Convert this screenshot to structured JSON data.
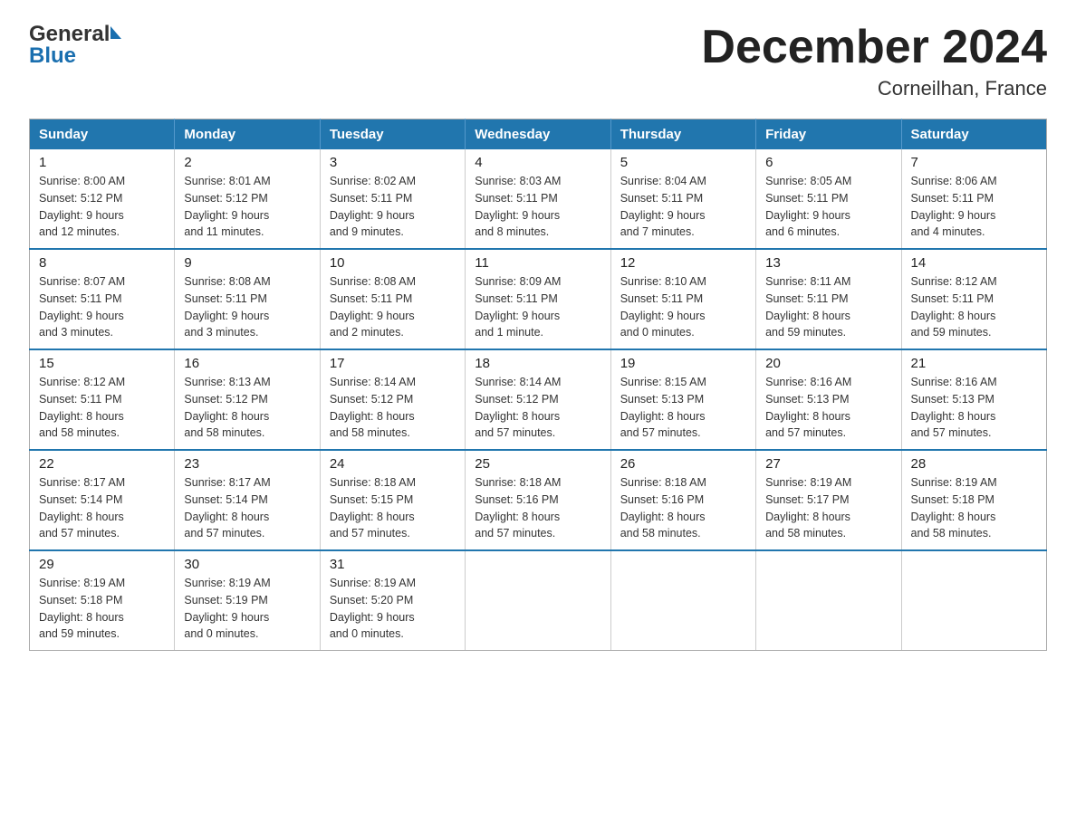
{
  "header": {
    "logo_line1": "General",
    "logo_line2": "Blue",
    "title": "December 2024",
    "subtitle": "Corneilhan, France"
  },
  "calendar": {
    "days_of_week": [
      "Sunday",
      "Monday",
      "Tuesday",
      "Wednesday",
      "Thursday",
      "Friday",
      "Saturday"
    ],
    "weeks": [
      [
        {
          "day": "1",
          "info": "Sunrise: 8:00 AM\nSunset: 5:12 PM\nDaylight: 9 hours\nand 12 minutes."
        },
        {
          "day": "2",
          "info": "Sunrise: 8:01 AM\nSunset: 5:12 PM\nDaylight: 9 hours\nand 11 minutes."
        },
        {
          "day": "3",
          "info": "Sunrise: 8:02 AM\nSunset: 5:11 PM\nDaylight: 9 hours\nand 9 minutes."
        },
        {
          "day": "4",
          "info": "Sunrise: 8:03 AM\nSunset: 5:11 PM\nDaylight: 9 hours\nand 8 minutes."
        },
        {
          "day": "5",
          "info": "Sunrise: 8:04 AM\nSunset: 5:11 PM\nDaylight: 9 hours\nand 7 minutes."
        },
        {
          "day": "6",
          "info": "Sunrise: 8:05 AM\nSunset: 5:11 PM\nDaylight: 9 hours\nand 6 minutes."
        },
        {
          "day": "7",
          "info": "Sunrise: 8:06 AM\nSunset: 5:11 PM\nDaylight: 9 hours\nand 4 minutes."
        }
      ],
      [
        {
          "day": "8",
          "info": "Sunrise: 8:07 AM\nSunset: 5:11 PM\nDaylight: 9 hours\nand 3 minutes."
        },
        {
          "day": "9",
          "info": "Sunrise: 8:08 AM\nSunset: 5:11 PM\nDaylight: 9 hours\nand 3 minutes."
        },
        {
          "day": "10",
          "info": "Sunrise: 8:08 AM\nSunset: 5:11 PM\nDaylight: 9 hours\nand 2 minutes."
        },
        {
          "day": "11",
          "info": "Sunrise: 8:09 AM\nSunset: 5:11 PM\nDaylight: 9 hours\nand 1 minute."
        },
        {
          "day": "12",
          "info": "Sunrise: 8:10 AM\nSunset: 5:11 PM\nDaylight: 9 hours\nand 0 minutes."
        },
        {
          "day": "13",
          "info": "Sunrise: 8:11 AM\nSunset: 5:11 PM\nDaylight: 8 hours\nand 59 minutes."
        },
        {
          "day": "14",
          "info": "Sunrise: 8:12 AM\nSunset: 5:11 PM\nDaylight: 8 hours\nand 59 minutes."
        }
      ],
      [
        {
          "day": "15",
          "info": "Sunrise: 8:12 AM\nSunset: 5:11 PM\nDaylight: 8 hours\nand 58 minutes."
        },
        {
          "day": "16",
          "info": "Sunrise: 8:13 AM\nSunset: 5:12 PM\nDaylight: 8 hours\nand 58 minutes."
        },
        {
          "day": "17",
          "info": "Sunrise: 8:14 AM\nSunset: 5:12 PM\nDaylight: 8 hours\nand 58 minutes."
        },
        {
          "day": "18",
          "info": "Sunrise: 8:14 AM\nSunset: 5:12 PM\nDaylight: 8 hours\nand 57 minutes."
        },
        {
          "day": "19",
          "info": "Sunrise: 8:15 AM\nSunset: 5:13 PM\nDaylight: 8 hours\nand 57 minutes."
        },
        {
          "day": "20",
          "info": "Sunrise: 8:16 AM\nSunset: 5:13 PM\nDaylight: 8 hours\nand 57 minutes."
        },
        {
          "day": "21",
          "info": "Sunrise: 8:16 AM\nSunset: 5:13 PM\nDaylight: 8 hours\nand 57 minutes."
        }
      ],
      [
        {
          "day": "22",
          "info": "Sunrise: 8:17 AM\nSunset: 5:14 PM\nDaylight: 8 hours\nand 57 minutes."
        },
        {
          "day": "23",
          "info": "Sunrise: 8:17 AM\nSunset: 5:14 PM\nDaylight: 8 hours\nand 57 minutes."
        },
        {
          "day": "24",
          "info": "Sunrise: 8:18 AM\nSunset: 5:15 PM\nDaylight: 8 hours\nand 57 minutes."
        },
        {
          "day": "25",
          "info": "Sunrise: 8:18 AM\nSunset: 5:16 PM\nDaylight: 8 hours\nand 57 minutes."
        },
        {
          "day": "26",
          "info": "Sunrise: 8:18 AM\nSunset: 5:16 PM\nDaylight: 8 hours\nand 58 minutes."
        },
        {
          "day": "27",
          "info": "Sunrise: 8:19 AM\nSunset: 5:17 PM\nDaylight: 8 hours\nand 58 minutes."
        },
        {
          "day": "28",
          "info": "Sunrise: 8:19 AM\nSunset: 5:18 PM\nDaylight: 8 hours\nand 58 minutes."
        }
      ],
      [
        {
          "day": "29",
          "info": "Sunrise: 8:19 AM\nSunset: 5:18 PM\nDaylight: 8 hours\nand 59 minutes."
        },
        {
          "day": "30",
          "info": "Sunrise: 8:19 AM\nSunset: 5:19 PM\nDaylight: 9 hours\nand 0 minutes."
        },
        {
          "day": "31",
          "info": "Sunrise: 8:19 AM\nSunset: 5:20 PM\nDaylight: 9 hours\nand 0 minutes."
        },
        {
          "day": "",
          "info": ""
        },
        {
          "day": "",
          "info": ""
        },
        {
          "day": "",
          "info": ""
        },
        {
          "day": "",
          "info": ""
        }
      ]
    ]
  }
}
